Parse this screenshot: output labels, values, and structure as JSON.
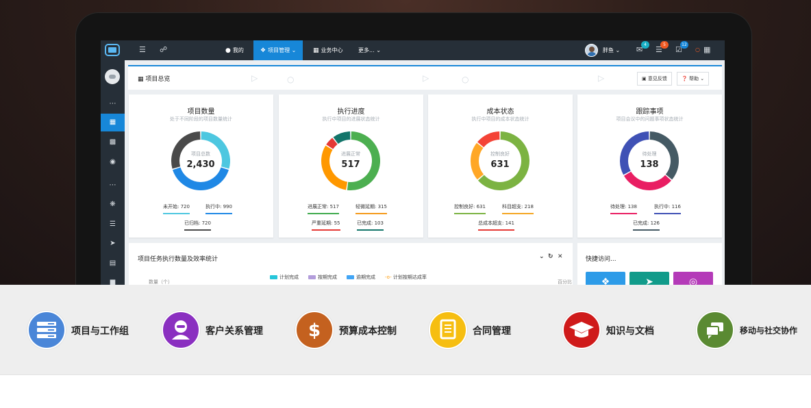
{
  "topbar": {
    "menus": [
      {
        "label": "我的"
      },
      {
        "label": "项目管理"
      },
      {
        "label": "业务中心"
      },
      {
        "label": "更多..."
      }
    ],
    "user_name": "胖鱼",
    "badges": [
      "4",
      "5",
      "12"
    ]
  },
  "page": {
    "title": "项目总览",
    "feedback_label": "意见反馈",
    "help_label": "帮助"
  },
  "cards": [
    {
      "title": "项目数量",
      "subtitle": "处于不同阶段的项目数量统计",
      "center_label": "项目总数",
      "center_value": "2,430",
      "legend": [
        "未开始: 720",
        "执行中: 990",
        "已归档: 720"
      ],
      "legend_colors": [
        "#4dc7e0",
        "#1f88e5",
        "#4a4a4a"
      ],
      "segments": [
        {
          "value": 720,
          "color": "#4dc7e0"
        },
        {
          "value": 990,
          "color": "#1f88e5"
        },
        {
          "value": 720,
          "color": "#4a4a4a"
        }
      ]
    },
    {
      "title": "执行进度",
      "subtitle": "执行中项目的进展状态统计",
      "center_label": "进展正常",
      "center_value": "517",
      "legend": [
        "进展正常: 517",
        "轻微延期: 315",
        "严重延期: 55",
        "已完成: 103"
      ],
      "legend_colors": [
        "#3faa4d",
        "#f59a1b",
        "#e53935",
        "#13756a"
      ],
      "segments": [
        {
          "value": 517,
          "color": "#4caf50"
        },
        {
          "value": 315,
          "color": "#ff9800"
        },
        {
          "value": 55,
          "color": "#e53935"
        },
        {
          "value": 103,
          "color": "#13756a"
        }
      ]
    },
    {
      "title": "成本状态",
      "subtitle": "执行中项目的成本状态统计",
      "center_label": "控制良好",
      "center_value": "631",
      "legend": [
        "控制良好: 631",
        "科目超支: 218",
        "总成本超支: 141"
      ],
      "legend_colors": [
        "#7cb342",
        "#f5a623",
        "#e53935"
      ],
      "segments": [
        {
          "value": 631,
          "color": "#7cb342"
        },
        {
          "value": 218,
          "color": "#ffa726"
        },
        {
          "value": 141,
          "color": "#f44336"
        }
      ]
    },
    {
      "title": "跟踪事项",
      "subtitle": "项目会议中的问题事项状态统计",
      "center_label": "待处理",
      "center_value": "138",
      "legend": [
        "待处理: 138",
        "执行中: 116",
        "已完成: 126"
      ],
      "legend_colors": [
        "#e91e63",
        "#3f51b5",
        "#455a64"
      ],
      "segments": [
        {
          "value": 138,
          "color": "#455a64"
        },
        {
          "value": 116,
          "color": "#e91e63"
        },
        {
          "value": 126,
          "color": "#3f51b5"
        }
      ]
    }
  ],
  "task_panel": {
    "title": "项目任务执行数量及效率统计",
    "legend": [
      "计划完成",
      "按期完成",
      "逾期完成",
      "计划按期达成率"
    ],
    "legend_colors": [
      "#26c6da",
      "#b39ddb",
      "#42a5f5",
      "#ff9800"
    ],
    "y_left": "数量（个）",
    "y_right": "百分比（%）"
  },
  "quick_panel": {
    "title": "快捷访问..."
  },
  "features": [
    {
      "label": "项目与工作组",
      "color": "#4a86d8",
      "icon": "server-icon"
    },
    {
      "label": "客户关系管理",
      "color": "#8a2fc0",
      "icon": "person-icon"
    },
    {
      "label": "预算成本控制",
      "color": "#c4611f",
      "icon": "dollar-icon"
    },
    {
      "label": "合同管理",
      "color": "#f6be11",
      "icon": "document-icon"
    },
    {
      "label": "知识与文档",
      "color": "#cf1a1a",
      "icon": "graduation-cap-icon"
    },
    {
      "label": "移动与社交协作",
      "color": "#5a8a32",
      "icon": "chat-icon"
    }
  ]
}
